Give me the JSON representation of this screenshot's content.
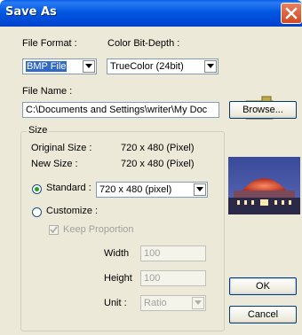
{
  "window": {
    "title": "Save As"
  },
  "labels": {
    "file_format": "File Format :",
    "color_bit_depth": "Color Bit-Depth :",
    "file_name": "File Name :",
    "size_group": "Size",
    "original_size_label": "Original Size :",
    "original_size_value": "720 x 480 (Pixel)",
    "new_size_label": "New Size :",
    "new_size_value": "720 x 480 (Pixel)",
    "standard": "Standard :",
    "customize": "Customize :",
    "keep_proportion": "Keep Proportion",
    "width": "Width",
    "height": "Height",
    "unit": "Unit :"
  },
  "fields": {
    "file_format_value": "BMP File",
    "color_depth_value": "TrueColor (24bit)",
    "file_name_value": "C:\\Documents and Settings\\writer\\My Doc",
    "standard_value": "720 x 480 (pixel)",
    "width_value": "100",
    "height_value": "100",
    "unit_value": "Ratio"
  },
  "buttons": {
    "browse": "Browse...",
    "ok": "OK",
    "cancel": "Cancel"
  },
  "state": {
    "size_mode": "Standard",
    "keep_proportion_checked": true
  },
  "icons": {
    "close": "close-icon",
    "camera": "camera-icon",
    "dropdown": "chevron-down-icon"
  },
  "colors": {
    "titlebar": "#0055e5",
    "accent_selection": "#316ac5",
    "face": "#ece9d8"
  }
}
